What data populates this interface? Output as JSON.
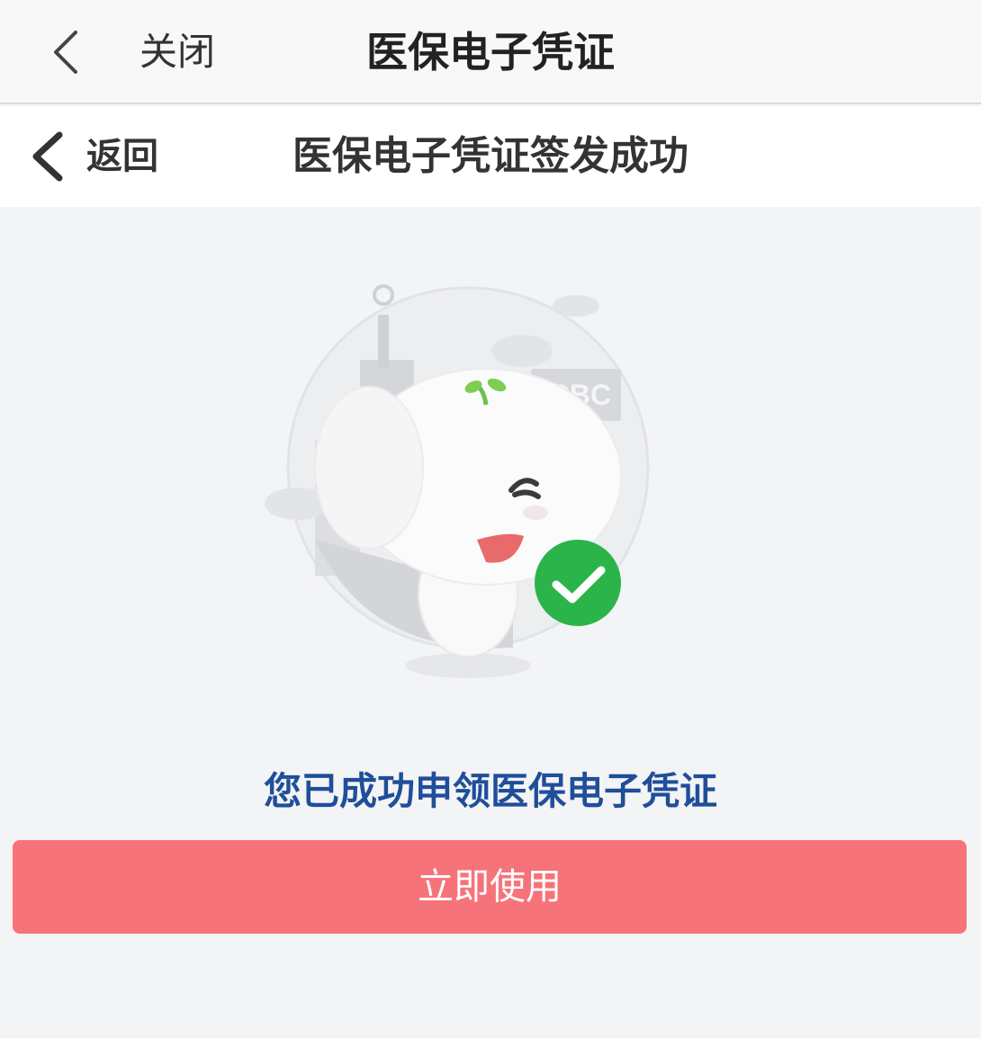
{
  "topbar": {
    "back_icon": "chevron-left-icon",
    "close_label": "关闭",
    "title": "医保电子凭证"
  },
  "subbar": {
    "back_icon": "chevron-left-icon",
    "back_label": "返回",
    "title": "医保电子凭证签发成功"
  },
  "hero": {
    "logo_text": "ICBC",
    "illustration": "mascot-success-illustration",
    "check_icon": "check-circle-icon",
    "check_color": "#2bb44a"
  },
  "main": {
    "message": "您已成功申领医保电子凭证",
    "message_color": "#1f4e9a",
    "use_button_label": "立即使用",
    "use_button_color": "#f7737a"
  }
}
